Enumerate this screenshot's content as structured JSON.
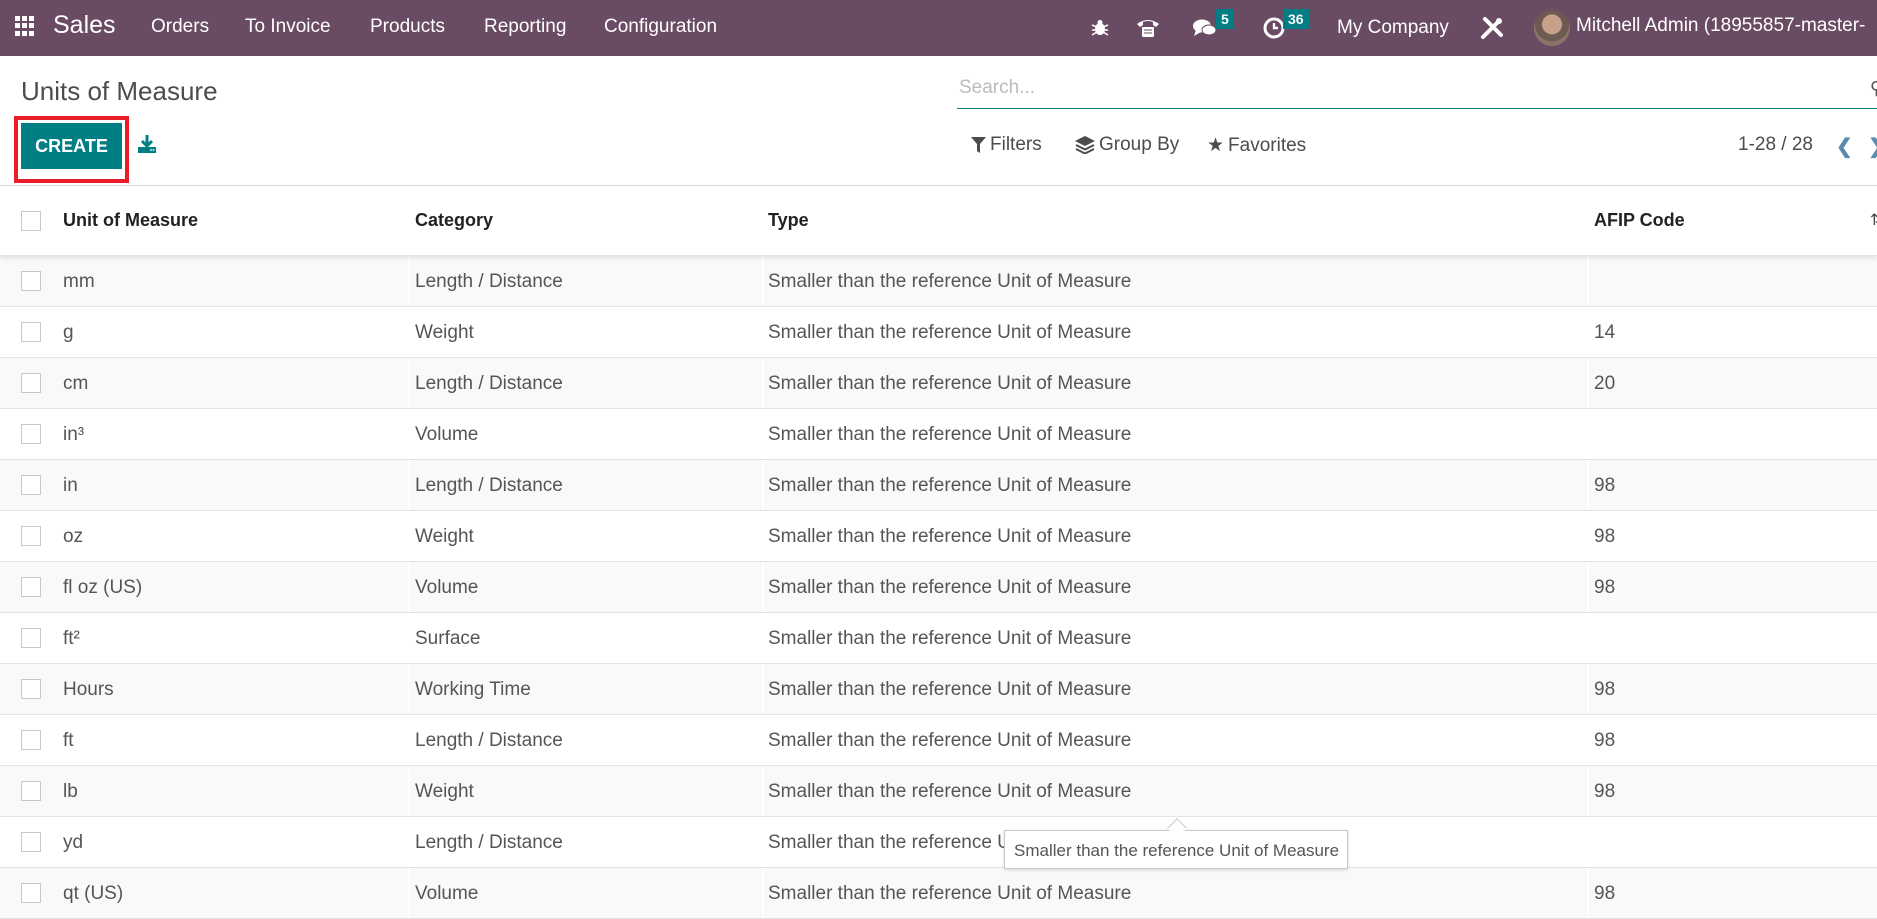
{
  "navbar": {
    "app_name": "Sales",
    "menu": [
      "Orders",
      "To Invoice",
      "Products",
      "Reporting",
      "Configuration"
    ],
    "icons": [
      "bug-icon",
      "phone-icon",
      "chat-icon",
      "clock-icon",
      "tools-icon"
    ],
    "messages_badge": "5",
    "activities_badge": "36",
    "company": "My Company",
    "user": "Mitchell Admin (18955857-master-"
  },
  "page": {
    "title": "Units of Measure",
    "create_label": "CREATE",
    "search_placeholder": "Search...",
    "filters_label": "Filters",
    "group_by_label": "Group By",
    "favorites_label": "Favorites",
    "pager": "1-28 / 28"
  },
  "table": {
    "columns": [
      "Unit of Measure",
      "Category",
      "Type",
      "AFIP Code"
    ],
    "rows": [
      {
        "uom": "mm",
        "category": "Length / Distance",
        "type": "Smaller than the reference Unit of Measure",
        "afip": ""
      },
      {
        "uom": "g",
        "category": "Weight",
        "type": "Smaller than the reference Unit of Measure",
        "afip": "14"
      },
      {
        "uom": "cm",
        "category": "Length / Distance",
        "type": "Smaller than the reference Unit of Measure",
        "afip": "20"
      },
      {
        "uom": "in³",
        "category": "Volume",
        "type": "Smaller than the reference Unit of Measure",
        "afip": ""
      },
      {
        "uom": "in",
        "category": "Length / Distance",
        "type": "Smaller than the reference Unit of Measure",
        "afip": "98"
      },
      {
        "uom": "oz",
        "category": "Weight",
        "type": "Smaller than the reference Unit of Measure",
        "afip": "98"
      },
      {
        "uom": "fl oz (US)",
        "category": "Volume",
        "type": "Smaller than the reference Unit of Measure",
        "afip": "98"
      },
      {
        "uom": "ft²",
        "category": "Surface",
        "type": "Smaller than the reference Unit of Measure",
        "afip": ""
      },
      {
        "uom": "Hours",
        "category": "Working Time",
        "type": "Smaller than the reference Unit of Measure",
        "afip": "98"
      },
      {
        "uom": "ft",
        "category": "Length / Distance",
        "type": "Smaller than the reference Unit of Measure",
        "afip": "98"
      },
      {
        "uom": "lb",
        "category": "Weight",
        "type": "Smaller than the reference Unit of Measure",
        "afip": "98"
      },
      {
        "uom": "yd",
        "category": "Length / Distance",
        "type": "Smaller than the reference Unit of Measure",
        "afip": ""
      },
      {
        "uom": "qt (US)",
        "category": "Volume",
        "type": "Smaller than the reference Unit of Measure",
        "afip": "98"
      }
    ]
  },
  "tooltip": {
    "text": "Smaller than the reference Unit of Measure"
  },
  "colors": {
    "navbar": "#6a4b64",
    "primary": "#017e84",
    "highlight_outline": "#e81d27"
  }
}
